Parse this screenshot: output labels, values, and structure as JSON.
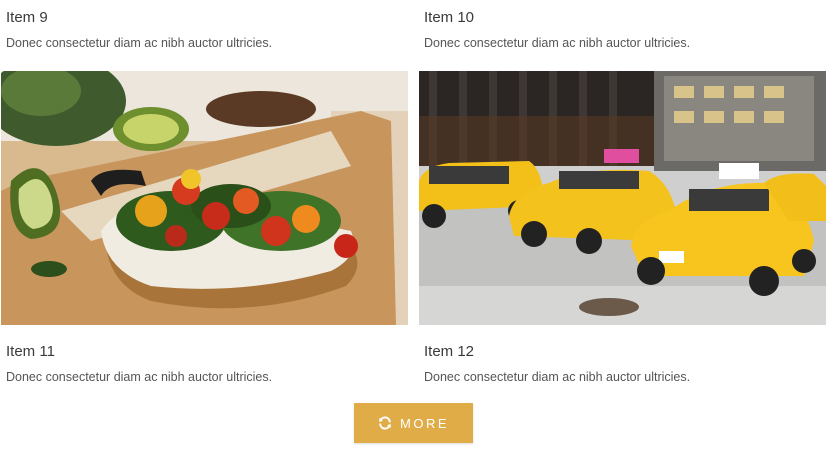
{
  "items": [
    {
      "title": "Item 9",
      "description": "Donec consectetur diam ac nibh auctor ultricies."
    },
    {
      "title": "Item 10",
      "description": "Donec consectetur diam ac nibh auctor ultricies."
    },
    {
      "title": "Item 11",
      "description": "Donec consectetur diam ac nibh auctor ultricies."
    },
    {
      "title": "Item 12",
      "description": "Donec consectetur diam ac nibh auctor ultricies."
    }
  ],
  "more_button": {
    "label": "MORE",
    "icon": "refresh-icon"
  },
  "colors": {
    "accent": "#e0ac48",
    "title": "#3a3a3a",
    "text": "#555555"
  }
}
